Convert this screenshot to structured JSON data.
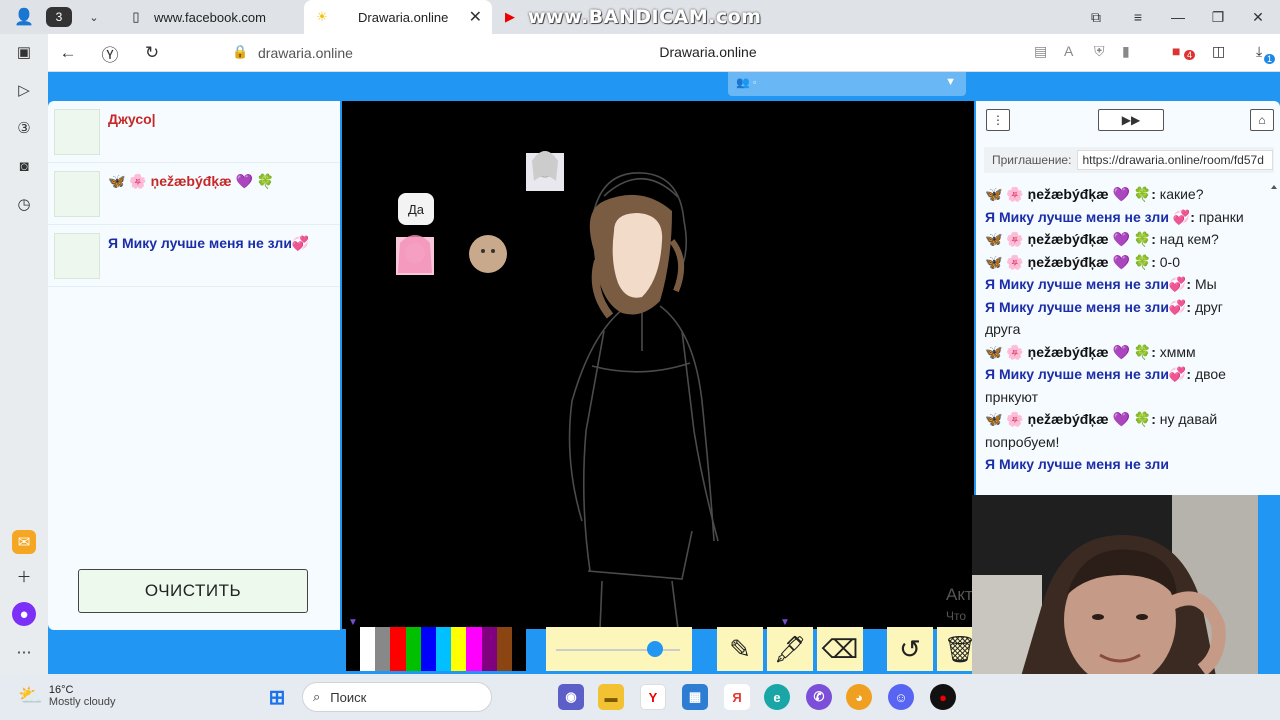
{
  "browser": {
    "tab_count": "3",
    "tabs": [
      {
        "label": "www.facebook.com"
      },
      {
        "label": "Drawaria.online"
      }
    ],
    "watermark": "www.BANDICAM.com",
    "address": {
      "url": "drawaria.online",
      "title": "Drawaria.online"
    },
    "download_badge": "1",
    "ext_badge": "4"
  },
  "page": {
    "players": [
      {
        "name": "Джусо|",
        "color": "#c62828"
      },
      {
        "name": "🦋 🌸 ņežæbýđķæ 💜 🍀",
        "color": "#c62828"
      },
      {
        "name": "Я Мику лучше меня не зли💞",
        "color": "#1b2ea8"
      }
    ],
    "clear_button": "ОЧИСТИТЬ",
    "speech_bubble": "Да",
    "brush_size": 0.8,
    "palette": [
      "#ffffff",
      "#888888",
      "#ff0000",
      "#00c000",
      "#0000ff",
      "#00c0ff",
      "#ffff00",
      "#ff00ff",
      "#800080",
      "#8b4513"
    ],
    "chat": {
      "invite_label": "Приглашение:",
      "invite_url": "https://drawaria.online/room/fd57d",
      "messages": [
        {
          "user": "🦋 🌸 ņežæbýđķæ 💜 🍀",
          "utype": "u1",
          "text": "какие?"
        },
        {
          "user": "Я Мику лучше меня не зли 💞",
          "utype": "u2",
          "text": "пранки"
        },
        {
          "user": "🦋 🌸 ņežæbýđķæ 💜 🍀",
          "utype": "u1",
          "text": "над кем?"
        },
        {
          "user": "🦋 🌸 ņežæbýđķæ 💜 🍀",
          "utype": "u1",
          "text": "0-0"
        },
        {
          "user": "Я Мику лучше меня не зли💞",
          "utype": "u2",
          "text": "Мы"
        },
        {
          "user": "Я Мику лучше меня не зли💞",
          "utype": "u2",
          "text": "друг друга"
        },
        {
          "user": "🦋 🌸 ņežæbýđķæ 💜 🍀",
          "utype": "u1",
          "text": "хммм"
        },
        {
          "user": "Я Мику лучше меня не зли💞",
          "utype": "u2",
          "text": "двое прнкуют"
        },
        {
          "user": "🦋 🌸 ņežæbýđķæ 💜 🍀",
          "utype": "u1",
          "text": "ну давай попробуем!"
        },
        {
          "user": "Я Мику лучше меня не зли",
          "utype": "u2",
          "text": ""
        }
      ]
    },
    "activation_text": [
      "Акт",
      "Что"
    ]
  },
  "taskbar": {
    "weather": {
      "temp": "16°C",
      "desc": "Mostly cloudy"
    },
    "search_placeholder": "Поиск"
  }
}
